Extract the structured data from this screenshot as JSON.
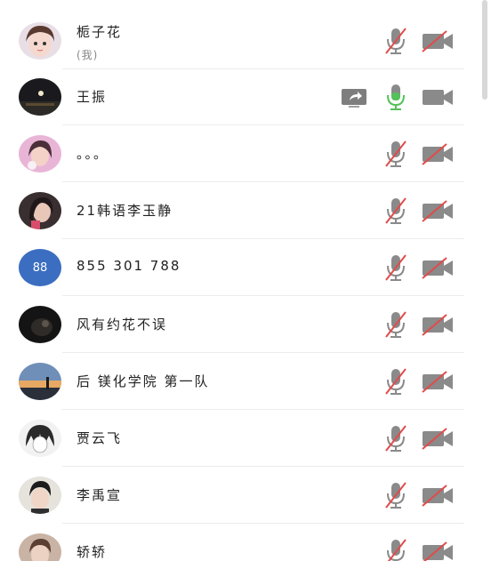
{
  "members": [
    {
      "name": "栀子花",
      "sub": "(我)",
      "avatar": "photo-girl-cartoon",
      "mic": "muted",
      "camera": "off",
      "sharing": false
    },
    {
      "name": "王振",
      "sub": "",
      "avatar": "photo-moon-night",
      "mic": "active",
      "camera": "idle",
      "sharing": true
    },
    {
      "name": "。。。",
      "sub": "",
      "avatar": "photo-girl-pink",
      "mic": "muted",
      "camera": "off",
      "sharing": false
    },
    {
      "name": "21韩语李玉静",
      "sub": "",
      "avatar": "photo-girl-portrait",
      "mic": "muted",
      "camera": "off",
      "sharing": false
    },
    {
      "name": "855 301 788",
      "sub": "",
      "avatar": "number-avatar",
      "avatar_text": "88",
      "mic": "muted",
      "camera": "off",
      "sharing": false
    },
    {
      "name": "风有约花不误",
      "sub": "",
      "avatar": "photo-dark-figure",
      "mic": "muted",
      "camera": "off",
      "sharing": false
    },
    {
      "name": "后 镁化学院 第一队",
      "sub": "",
      "avatar": "photo-sunset-landscape",
      "mic": "muted",
      "camera": "off",
      "sharing": false
    },
    {
      "name": "贾云飞",
      "sub": "",
      "avatar": "photo-anime-boy",
      "mic": "muted",
      "camera": "off",
      "sharing": false
    },
    {
      "name": "李禹宣",
      "sub": "",
      "avatar": "photo-boy-portrait",
      "mic": "muted",
      "camera": "off",
      "sharing": false
    },
    {
      "name": "轿轿",
      "sub": "",
      "avatar": "photo-girl-partial",
      "mic": "muted",
      "camera": "off",
      "sharing": false
    }
  ],
  "colors": {
    "muted_mic_red": "#e14b4b",
    "active_mic_green": "#55c15a",
    "icon_gray": "#8a8a8a",
    "number_avatar_blue": "#3b6ec0"
  }
}
